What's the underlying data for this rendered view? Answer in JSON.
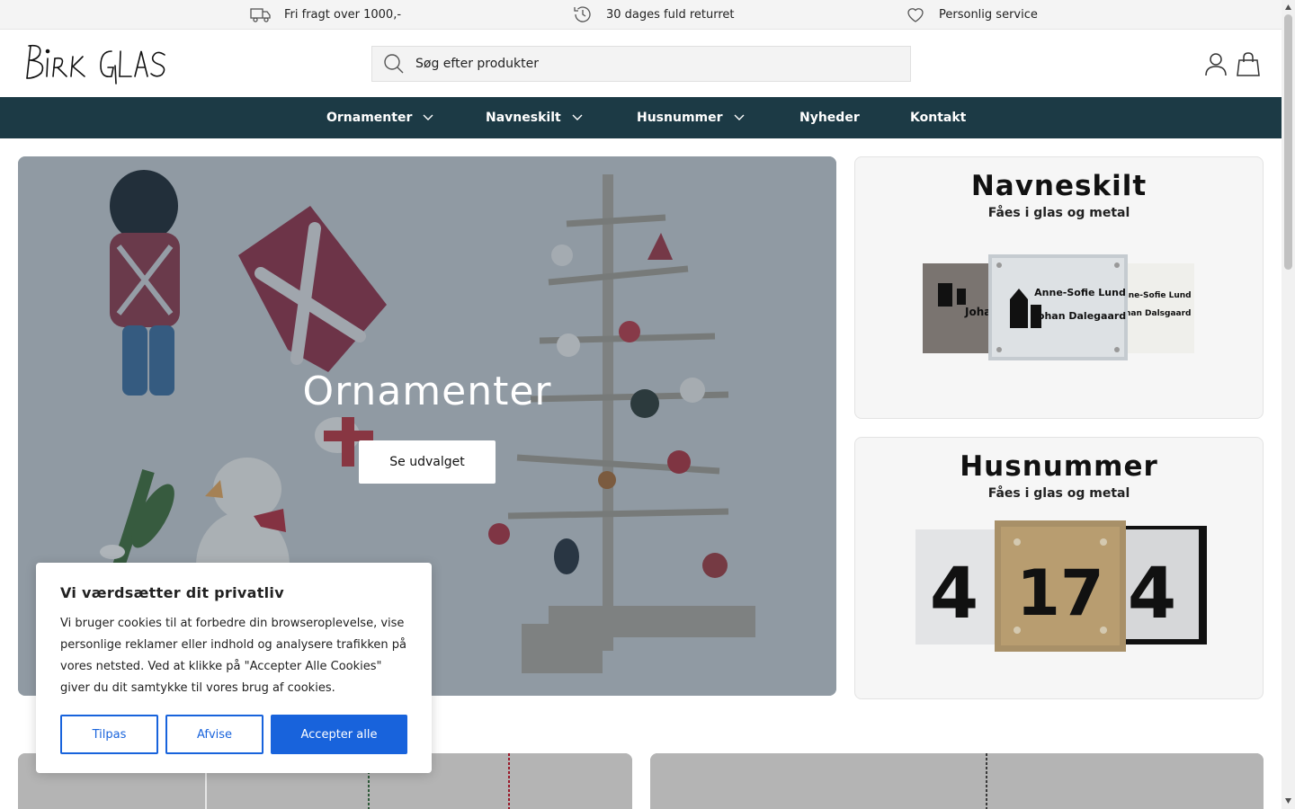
{
  "announcement": {
    "items": [
      {
        "icon": "truck-icon",
        "text": "Fri fragt over 1000,-"
      },
      {
        "icon": "clock-return-icon",
        "text": "30 dages fuld returret"
      },
      {
        "icon": "heart-icon",
        "text": "Personlig service"
      }
    ]
  },
  "header": {
    "logo_text": "BIRK GLAS",
    "search_placeholder": "Søg efter produkter",
    "icons": [
      "account-icon",
      "cart-icon"
    ]
  },
  "nav": {
    "items": [
      {
        "label": "Ornamenter",
        "has_dropdown": true
      },
      {
        "label": "Navneskilt",
        "has_dropdown": true
      },
      {
        "label": "Husnummer",
        "has_dropdown": true
      },
      {
        "label": "Nyheder",
        "has_dropdown": false
      },
      {
        "label": "Kontakt",
        "has_dropdown": false
      }
    ],
    "background": "#1c3a45"
  },
  "hero": {
    "title": "Ornamenter",
    "button": "Se udvalget"
  },
  "cards": [
    {
      "title": "Navneskilt",
      "subtitle": "Fåes i glas og metal",
      "sign_line1": "Anne-Sofie Lund",
      "sign_line2": "Johan Dalegaard",
      "sign_line2_alt": "Johan Dalsgaard",
      "sign_partial": "Johan"
    },
    {
      "title": "Husnummer",
      "subtitle": "Fåes i glas og metal",
      "numbers": [
        "4",
        "17",
        "4"
      ]
    }
  ],
  "cookie": {
    "title": "Vi værdsætter dit privatliv",
    "body": "Vi bruger cookies til at forbedre din browseroplevelse, vise personlige reklamer eller indhold og analysere trafikken på vores netsted. Ved at klikke på \"Accepter Alle Cookies\" giver du dit samtykke til vores brug af cookies.",
    "btn_customize": "Tilpas",
    "btn_reject": "Afvise",
    "btn_accept": "Accepter alle",
    "accent": "#1863dc"
  }
}
